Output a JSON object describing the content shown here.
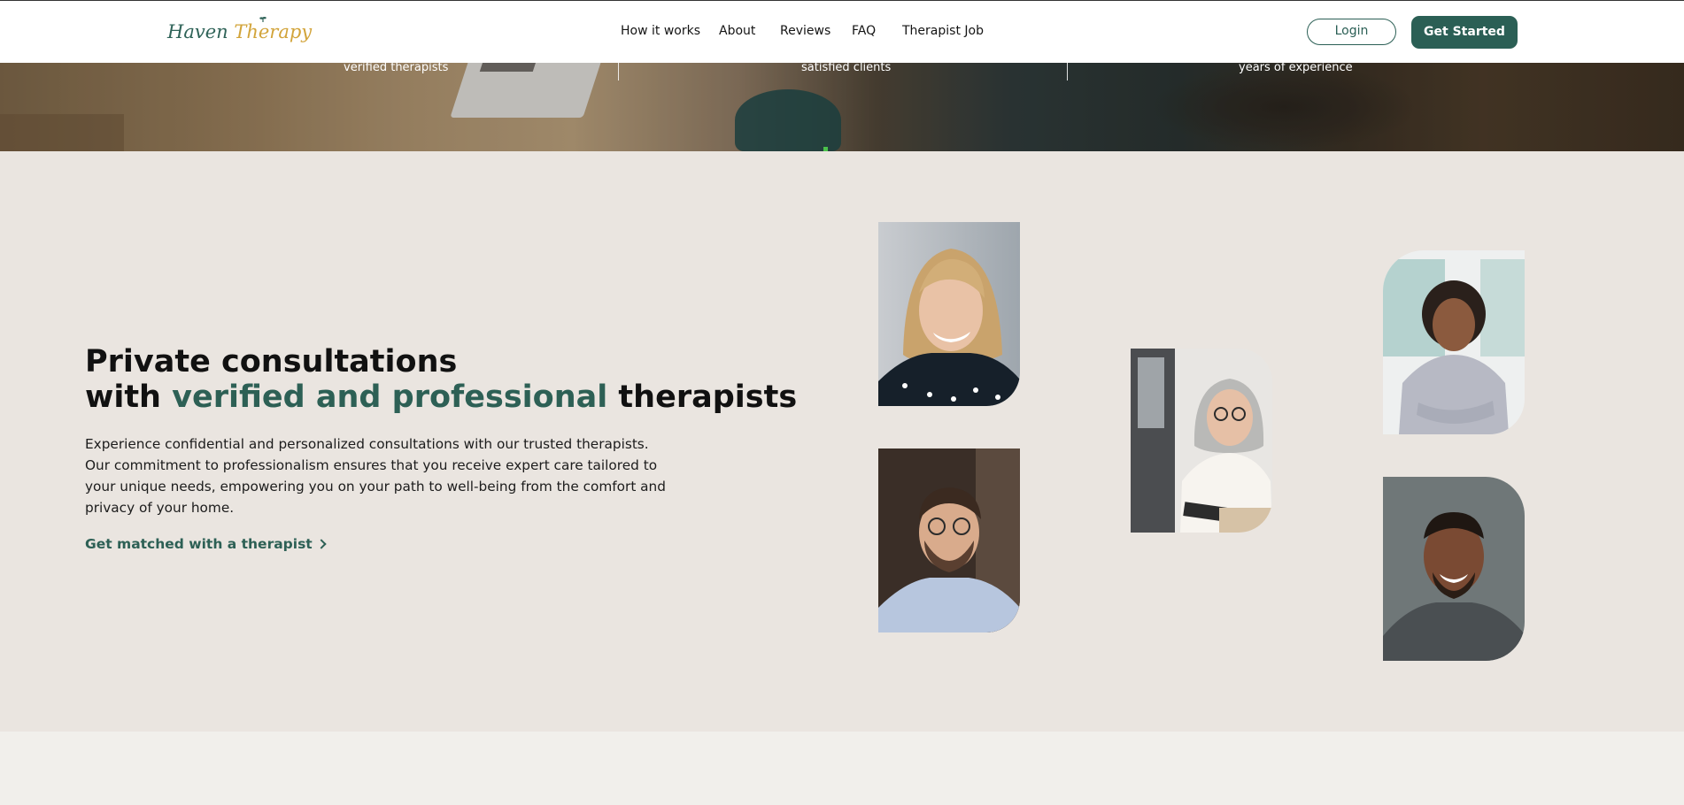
{
  "header": {
    "logo_word1": "Haven",
    "logo_word2": "Therapy",
    "nav": [
      "How it works",
      "About",
      "Reviews",
      "FAQ",
      "Therapist Job"
    ],
    "login_label": "Login",
    "get_started_label": "Get Started"
  },
  "stats": [
    {
      "label": "verified therapists"
    },
    {
      "label": "satisfied clients"
    },
    {
      "label": "years of experience"
    }
  ],
  "hero": {
    "title_line1": "Private consultations",
    "title_line2_pre": "with ",
    "title_line2_accent": "verified and professional",
    "title_line2_post": " therapists",
    "description": "Experience confidential and personalized consultations with our trusted therapists. Our commitment to professionalism ensures that you receive expert care tailored to your unique needs, empowering you on your path to well-being from the comfort and privacy of your home.",
    "cta_label": "Get matched with a therapist"
  },
  "photos": [
    {
      "name": "therapist-photo-blonde-woman"
    },
    {
      "name": "therapist-photo-man-glasses"
    },
    {
      "name": "therapist-photo-grey-haired-woman"
    },
    {
      "name": "therapist-photo-curly-haired-woman"
    },
    {
      "name": "therapist-photo-smiling-man"
    }
  ],
  "colors": {
    "brand_green": "#2b5f55",
    "logo_gold": "#d2a43a",
    "section_bg": "#eae5e0",
    "page_bg": "#f1efeb"
  }
}
